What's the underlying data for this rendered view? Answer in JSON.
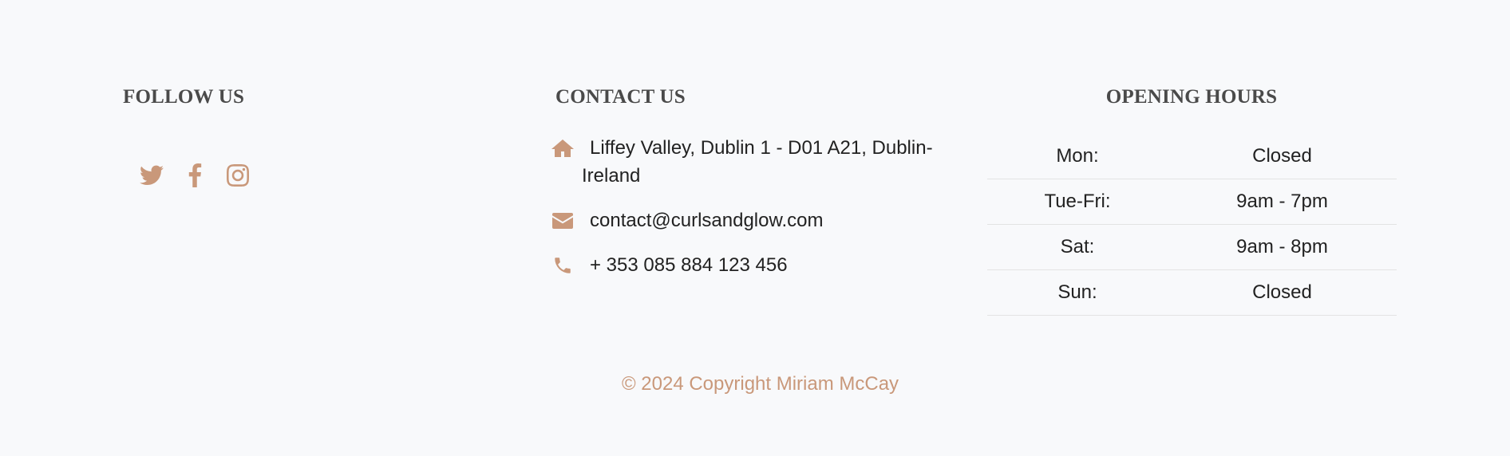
{
  "colors": {
    "background": "#f8f9fb",
    "accent": "#c9987a",
    "heading": "#4a4a4a",
    "text": "#222222",
    "divider": "#e3e3e3"
  },
  "follow": {
    "title": "FOLLOW US",
    "icons": [
      "twitter-icon",
      "facebook-icon",
      "instagram-icon"
    ]
  },
  "contact": {
    "title": "CONTACT US",
    "address_line1": "Liffey Valley, Dublin 1 - D01 A21, Dublin-",
    "address_line2": "Ireland",
    "email": "contact@curlsandglow.com",
    "phone": "+ 353 085 884 123 456",
    "icons": [
      "home-icon",
      "envelope-icon",
      "phone-icon"
    ]
  },
  "hours": {
    "title": "OPENING HOURS",
    "rows": [
      {
        "day": "Mon:",
        "time": "Closed"
      },
      {
        "day": "Tue-Fri:",
        "time": "9am - 7pm"
      },
      {
        "day": "Sat:",
        "time": "9am - 8pm"
      },
      {
        "day": "Sun:",
        "time": "Closed"
      }
    ]
  },
  "copyright": "© 2024 Copyright Miriam McCay"
}
